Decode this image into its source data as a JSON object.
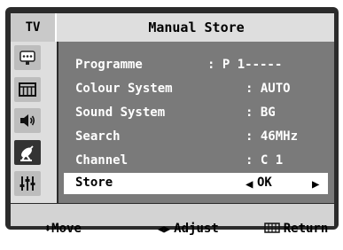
{
  "header": {
    "tab_label": "TV",
    "title": "Manual Store"
  },
  "sidebar": {
    "icons": [
      {
        "name": "input-icon",
        "active": false
      },
      {
        "name": "picture-icon",
        "active": false
      },
      {
        "name": "sound-icon",
        "active": false
      },
      {
        "name": "channel-antenna-icon",
        "active": true
      },
      {
        "name": "setup-sliders-icon",
        "active": false
      }
    ]
  },
  "menu": {
    "items": [
      {
        "label": "Programme",
        "value": ": P 1-----"
      },
      {
        "label": "Colour System",
        "value": ": AUTO"
      },
      {
        "label": "Sound System",
        "value": ": BG"
      },
      {
        "label": "Search",
        "value": ": 46MHz"
      },
      {
        "label": "Channel",
        "value": ": C 1"
      },
      {
        "label": "Store",
        "value": "OK"
      }
    ]
  },
  "footer": {
    "move_label": "Move",
    "adjust_label": "Adjust",
    "return_label": "Return"
  },
  "colors": {
    "selected_row_bg": "#ffffff",
    "list_bg": "#7a7a7a",
    "header_bg": "#dedede"
  }
}
